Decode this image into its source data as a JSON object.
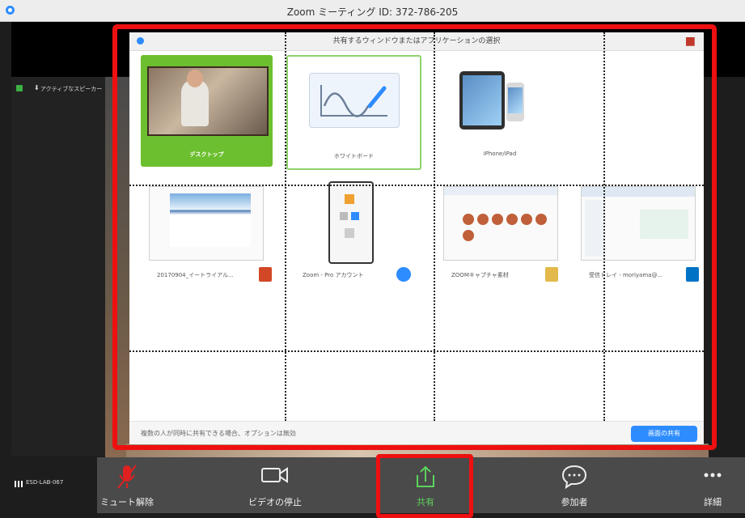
{
  "window": {
    "title": "Zoom ミーティング ID: 372-786-205"
  },
  "left_panel": {
    "speaker_label": "アクティブなスピーカー"
  },
  "dialog": {
    "title": "共有するウィンドウまたはアプリケーションの選択",
    "tiles_row1": [
      {
        "label": "デスクトップ"
      },
      {
        "label": "ホワイトボード"
      },
      {
        "label": "iPhone/iPad"
      }
    ],
    "tiles_row2": [
      {
        "label": "20170904_イートライアル..."
      },
      {
        "label": "Zoom - Pro アカウント"
      },
      {
        "label": "ZOOMキャプチャ素材"
      },
      {
        "label": "受信トレイ - moriyama@..."
      }
    ],
    "footer_note": "複数の人が同時に共有できる場合、オプションは無効",
    "share_button": "画面の共有"
  },
  "status": {
    "device_name": "ESD-LAB-067"
  },
  "toolbar": {
    "items": [
      {
        "label": "ミュート解除",
        "icon": "muted-mic-icon"
      },
      {
        "label": "ビデオの停止",
        "icon": "video-camera-icon"
      },
      {
        "label": "共有",
        "icon": "share-screen-icon"
      },
      {
        "label": "参加者",
        "icon": "chat-bubble-icon"
      },
      {
        "label": "詳細",
        "icon": "more-icon"
      }
    ]
  },
  "colors": {
    "accent_blue": "#2d8cff",
    "share_green": "#5cd35c",
    "highlight_red": "#ee1010",
    "desktop_tile_green": "#6cbf2f"
  }
}
